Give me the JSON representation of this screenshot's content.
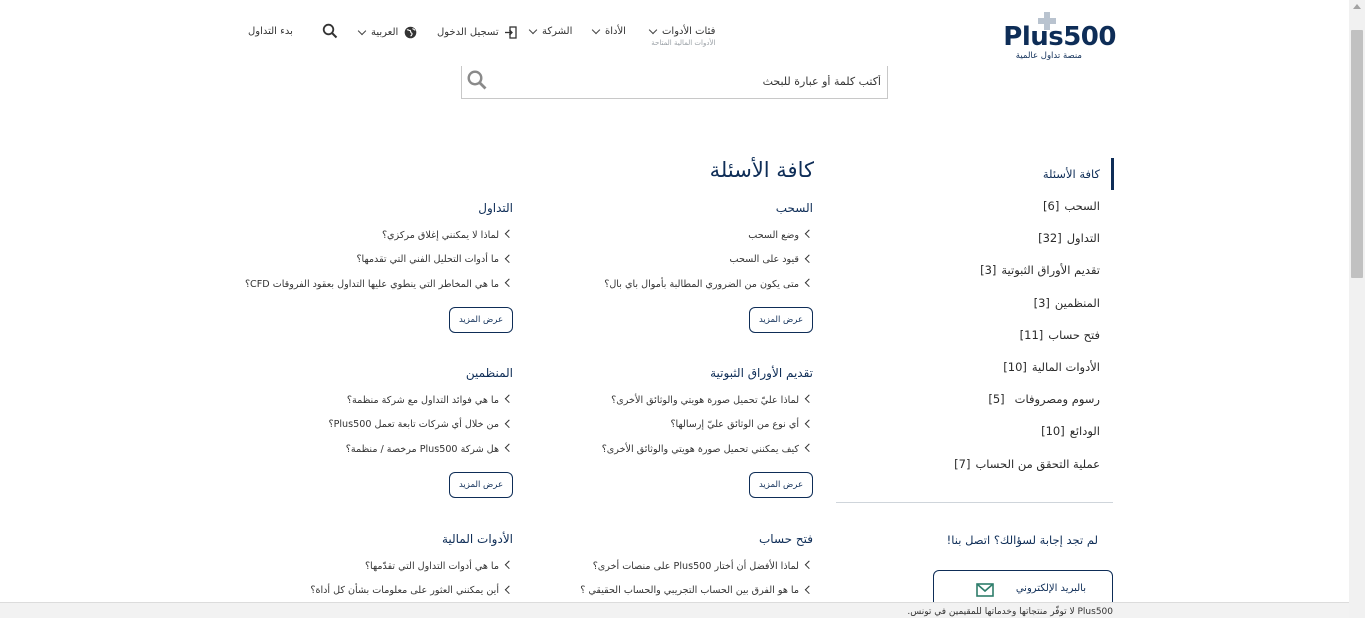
{
  "header": {
    "logo": {
      "word": "Plus500",
      "tagline": "منصة تداول عالمية"
    },
    "nav": {
      "instruments": "فئات الأدوات",
      "instruments_sub": "الأدوات المالية المتاحة",
      "tools": "الأداة",
      "company": "الشركة",
      "login": "تسجيل الدخول",
      "language": "العربية",
      "start_trading": "بدء التداول"
    }
  },
  "search": {
    "placeholder": "أكتب كلمة أو عبارة للبحث"
  },
  "sidebar": {
    "items": [
      {
        "label": "كافة الأسئلة",
        "count": "",
        "active": true
      },
      {
        "label": "السحب",
        "count": "[6]"
      },
      {
        "label": "التداول",
        "count": "[32]"
      },
      {
        "label": "تقديم الأوراق الثبوتية",
        "count": "[3]"
      },
      {
        "label": "المنظمين",
        "count": "[3]"
      },
      {
        "label": "فتح حساب",
        "count": "[11]"
      },
      {
        "label": "الأدوات المالية",
        "count": "[10]"
      },
      {
        "label": "رسوم ومصروفات",
        "count": "[5]"
      },
      {
        "label": "الودائع",
        "count": "[10]"
      },
      {
        "label": "عملية التحقق من الحساب",
        "count": "[7]"
      }
    ],
    "contact_question": "لم تجد إجابة لسؤالك؟ اتصل بنا!",
    "email_button": "بالبريد الإلكتروني"
  },
  "main": {
    "title": "كافة الأسئلة",
    "more_label": "عرض المزيد",
    "categories": [
      {
        "title": "السحب",
        "questions": [
          "وضع السحب",
          "قيود على السحب",
          "متى يكون من الضروري المطالبة بأموال باي بال؟"
        ]
      },
      {
        "title": "التداول",
        "questions": [
          "لماذا لا يمكنني إغلاق مركزي؟",
          "ما أدوات التحليل الفني التي تقدمها؟",
          "ما هي المخاطر التي ينطوي عليها التداول بعقود الفروقات CFD؟"
        ]
      },
      {
        "title": "تقديم الأوراق الثبوتية",
        "questions": [
          "لماذا عليّ تحميل صورة هويتي والوثائق الأخرى؟",
          "أي نوع من الوثائق عليّ إرسالها؟",
          "كيف يمكنني تحميل صورة هويتي والوثائق الأخرى؟"
        ]
      },
      {
        "title": "المنظمين",
        "questions": [
          "ما هي فوائد التداول مع شركة منظمة؟",
          "من خلال أي شركات تابعة تعمل Plus500؟",
          "هل شركة Plus500 مرخصة / منظمة؟"
        ]
      },
      {
        "title": "فتح حساب",
        "questions": [
          "لماذا الأفضل أن أختار Plus500 على منصات أخرى؟",
          "ما هو الفرق بين الحساب التجريبي والحساب الحقيقي ؟"
        ]
      },
      {
        "title": "الأدوات المالية",
        "questions": [
          "ما هي أدوات التداول التي تقدّمها؟",
          "أين يمكنني العثور على معلومات بشأن كل أداة؟"
        ]
      }
    ]
  },
  "notice": {
    "text": "Plus500 لا توفّر منتجاتها وخدماتها للمقيمين في تونس."
  },
  "colors": {
    "brand": "#0e2d57",
    "divider": "#cfd5db"
  }
}
